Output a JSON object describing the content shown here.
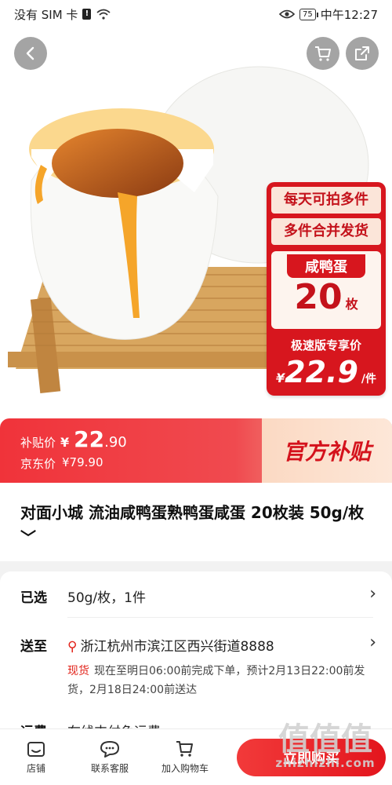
{
  "status_bar": {
    "carrier": "没有 SIM 卡",
    "battery": "75",
    "time": "中午12:27"
  },
  "hero": {
    "badge_line1": "每天可拍多件",
    "badge_line2": "多件合并发货",
    "product_label": "咸鸭蛋",
    "count": "20",
    "count_unit": "枚",
    "promo_tag": "极速版专享价",
    "promo_currency": "¥",
    "promo_price": "22.9",
    "promo_unit": "/件"
  },
  "subsidy": {
    "subsidy_label": "补贴价",
    "subsidy_currency": "¥",
    "subsidy_int": "22",
    "subsidy_dec": ".90",
    "jd_label": "京东价",
    "jd_price": "¥79.90",
    "official_label": "官方补贴"
  },
  "product": {
    "title": "对面小城 流油咸鸭蛋熟鸭蛋咸蛋  20枚装 50g/枚",
    "title_chevron": "﹀"
  },
  "detail": {
    "selected_key": "已选",
    "selected_value": "50g/枚，1件",
    "ship_key": "送至",
    "ship_address": "浙江杭州市滨江区西兴街道8888",
    "stock_label": "现货",
    "ship_note": "现在至明日06:00前完成下单，预计2月13日22:00前发货，2月18日24:00前送达",
    "freight_key": "运费",
    "freight_value": "在线支付免运费"
  },
  "bottom_bar": {
    "store": "店铺",
    "service": "联系客服",
    "cart": "加入购物车",
    "buy": "立即购买"
  },
  "watermark": {
    "text": "值值值",
    "url": "zhizhizhi.com"
  },
  "colors": {
    "accent_red": "#e2231a",
    "subsidy_bg": "#f0333a"
  }
}
